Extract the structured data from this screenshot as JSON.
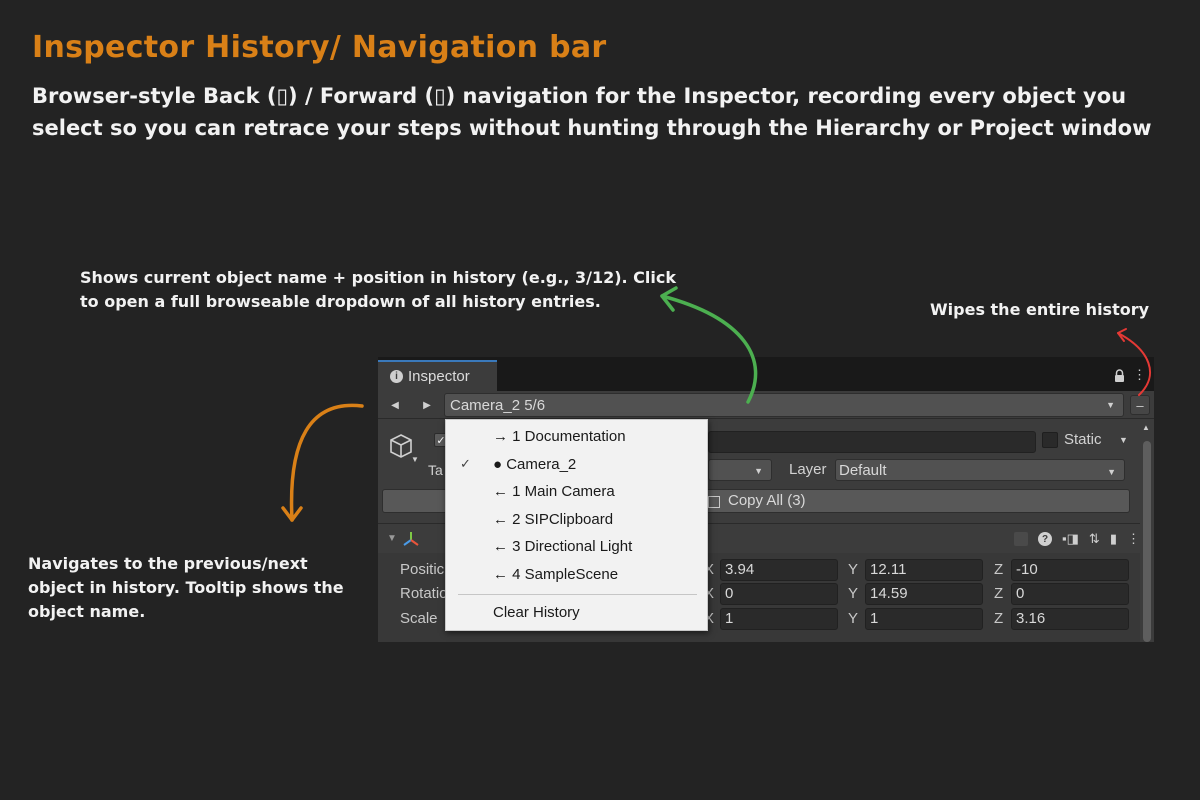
{
  "page": {
    "title": "Inspector History/ Navigation bar",
    "subtitle": "Browser-style Back (▯) / Forward (▯) navigation for the Inspector, recording every object you select so you can retrace your steps without hunting through the Hierarchy or Project window"
  },
  "annotations": {
    "dropdown_note": "Shows current object name + position in history (e.g., 3/12). Click to open a full browseable dropdown of all history entries.",
    "clear_note": "Wipes the entire history",
    "nav_note": "Navigates to the previous/next object in history. Tooltip shows the object name."
  },
  "colors": {
    "headline": "#d98017",
    "green_arrow": "#4caf50",
    "red_arrow": "#e53935",
    "orange_arrow": "#d98017",
    "tab_accent": "#3a79bb"
  },
  "inspector": {
    "tab_label": "Inspector",
    "tab_icon": "info-icon",
    "lock_icon": "lock-icon",
    "menu_icon": "⋮",
    "nav": {
      "back_icon": "◀",
      "forward_icon": "▶",
      "current": "Camera_2  5/6",
      "clear_icon": "–"
    },
    "gameobject": {
      "check": "✓",
      "static_label": "Static",
      "tag_label": "Ta",
      "layer_label": "Layer",
      "layer_value": "Default",
      "copy_label": "Copy All (3)"
    },
    "transform": {
      "rows": [
        {
          "label": "Positic",
          "x": "3.94",
          "y": "12.11",
          "z": "-10"
        },
        {
          "label": "Rotatio",
          "x": "0",
          "y": "14.59",
          "z": "0"
        },
        {
          "label": "Scale",
          "x": "1",
          "y": "1",
          "z": "3.16"
        }
      ],
      "axis_x": "X",
      "axis_y": "Y",
      "axis_z": "Z"
    }
  },
  "history_menu": {
    "items": [
      {
        "label": "→ 1  Documentation",
        "checked": false
      },
      {
        "label": "● Camera_2",
        "checked": true
      },
      {
        "label": "← 1  Main Camera",
        "checked": false
      },
      {
        "label": "← 2  SIPClipboard",
        "checked": false
      },
      {
        "label": "← 3  Directional Light",
        "checked": false
      },
      {
        "label": "← 4  SampleScene",
        "checked": false
      }
    ],
    "check_mark": "✓",
    "clear_label": "Clear History"
  }
}
